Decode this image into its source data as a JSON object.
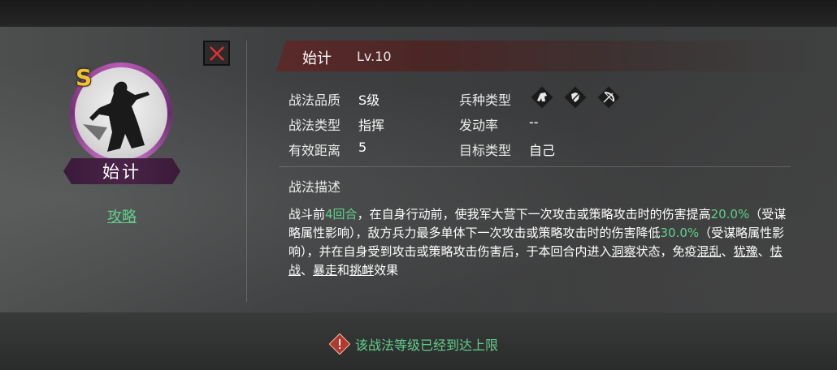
{
  "tactic": {
    "name": "始计",
    "level": "Lv.10",
    "grade": "S",
    "guide_link": "攻略"
  },
  "info": {
    "quality_label": "战法品质",
    "quality_value": "S级",
    "type_label": "战法类型",
    "type_value": "指挥",
    "range_label": "有效距离",
    "range_value": "5",
    "troop_label": "兵种类型",
    "troop_icons": [
      "cavalry-icon",
      "shield-icon",
      "bow-icon"
    ],
    "rate_label": "发动率",
    "rate_value": "--",
    "target_label": "目标类型",
    "target_value": "自己"
  },
  "description": {
    "title": "战法描述",
    "p1": "战斗前",
    "p1_hl": "4回合",
    "p2": "，在自身行动前，使我军大营下一次攻击或策略攻击时的伤害提高",
    "p2_hl": "20.0%",
    "p3": "（受谋略属性影响），敌方兵力最多单体下一次攻击或策略攻击时的伤害降低",
    "p3_hl": "30.0%",
    "p4": "（受谋略属性影响），并在自身受到攻击或策略攻击伤害后，于本回合内进入",
    "kw1": "洞察",
    "p5": "状态，免疫",
    "kw2": "混乱",
    "s1": "、",
    "kw3": "犹豫",
    "s2": "、",
    "kw4": "怯战",
    "s3": "、",
    "kw5": "暴走",
    "s4": "和",
    "kw6": "挑衅",
    "p6": "效果"
  },
  "notice": {
    "text": "该战法等级已经到达上限",
    "icon": "warning-icon"
  },
  "colors": {
    "highlight_green": "#5fd08a",
    "grade_gold": "#f0c232",
    "frame_purple": "#b95ab4",
    "close_red": "#e03030"
  }
}
